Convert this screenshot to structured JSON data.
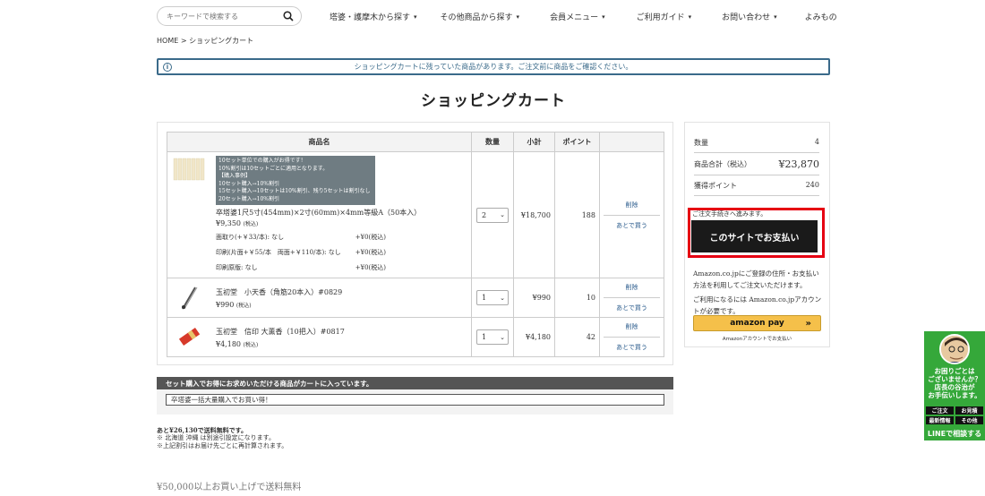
{
  "search": {
    "placeholder": "キーワードで検索する"
  },
  "nav": [
    {
      "label": "塔婆・護摩木から探す"
    },
    {
      "label": "その他商品から探す"
    },
    {
      "label": "会員メニュー"
    },
    {
      "label": "ご利用ガイド"
    },
    {
      "label": "お問い合わせ"
    },
    {
      "label": "よみもの"
    }
  ],
  "breadcrumb": {
    "home": "HOME",
    "sep": ">",
    "current": "ショッピングカート"
  },
  "notice": "ショッピングカートに残っていた商品があります。ご注文前に商品をご確認ください。",
  "page_title": "ショッピングカート",
  "cart": {
    "headers": [
      "商品名",
      "数量",
      "小計",
      "ポイント",
      ""
    ],
    "items": [
      {
        "promo": [
          "10セット単位での購入がお得です！",
          "10%割引は10セットごとに適用となります。",
          "【購入事例】",
          "10セット購入→10%割引",
          "15セット購入→10セットは10%割引、残り5セットは割引なし",
          "20セット購入→10%割引"
        ],
        "name": "卒塔婆1尺5寸(454mm)×2寸(60mm)×4mm等級A（50本入）",
        "price": "¥9,350",
        "tax": "(税込)",
        "options": [
          {
            "label": "面取り(+￥33/本): なし",
            "value": "+¥0(税込)"
          },
          {
            "label": "印刷(片面+￥55/本　両面+￥110/本): なし",
            "value": "+¥0(税込)"
          },
          {
            "label": "印刷原版: なし",
            "value": "+¥0(税込)"
          }
        ],
        "qty": "2",
        "subtotal": "¥18,700",
        "points": "188",
        "delete": "削除",
        "later": "あとで買う"
      },
      {
        "name": "玉初堂　小天香（角筋20本入）#0829",
        "price": "¥990",
        "tax": "(税込)",
        "qty": "1",
        "subtotal": "¥990",
        "points": "10",
        "delete": "削除",
        "later": "あとで買う"
      },
      {
        "name": "玉初堂　信印 大薫香（10把入）#0817",
        "price": "¥4,180",
        "tax": "(税込)",
        "qty": "1",
        "subtotal": "¥4,180",
        "points": "42",
        "delete": "削除",
        "later": "あとで買う"
      }
    ]
  },
  "summary": {
    "qty_label": "数量",
    "qty_value": "4",
    "total_label": "商品合計（税込）",
    "total_value": "¥23,870",
    "points_label": "獲得ポイント",
    "points_value": "240",
    "proceed_note": "ご注文手続きへ進みます。",
    "pay_button": "このサイトでお支払い",
    "amazon_info": [
      "Amazon.co.jpにご登録の住所・お支払い方法を利用してご注文いただけます。",
      "ご利用になるには Amazon.co.jpアカウントが必要です。"
    ],
    "amazon_button": "amazon pay",
    "amazon_arrow": "»",
    "amazon_sub": "Amazonアカウントでお支払い"
  },
  "set_section": {
    "header": "セット購入でお得にお求めいただける商品がカートに入っています。",
    "link": "卒塔婆一括大量購入でお買い得！"
  },
  "shipping": {
    "line1": "あと¥26,130で送料無料です。",
    "line2": "※ 北海道 沖縄 は別途引設定になります。",
    "line3": "※上記割引はお届け先ごとに再計算されます。",
    "free": "¥50,000以上お買い上げで送料無料"
  },
  "line_widget": {
    "message": [
      "お困りごとは",
      "ございませんか？",
      "店長の谷治が",
      "お手伝いします。"
    ],
    "grid": [
      "ご注文",
      "お見積",
      "最新情報",
      "その他"
    ],
    "button": "LINEで相談する"
  }
}
